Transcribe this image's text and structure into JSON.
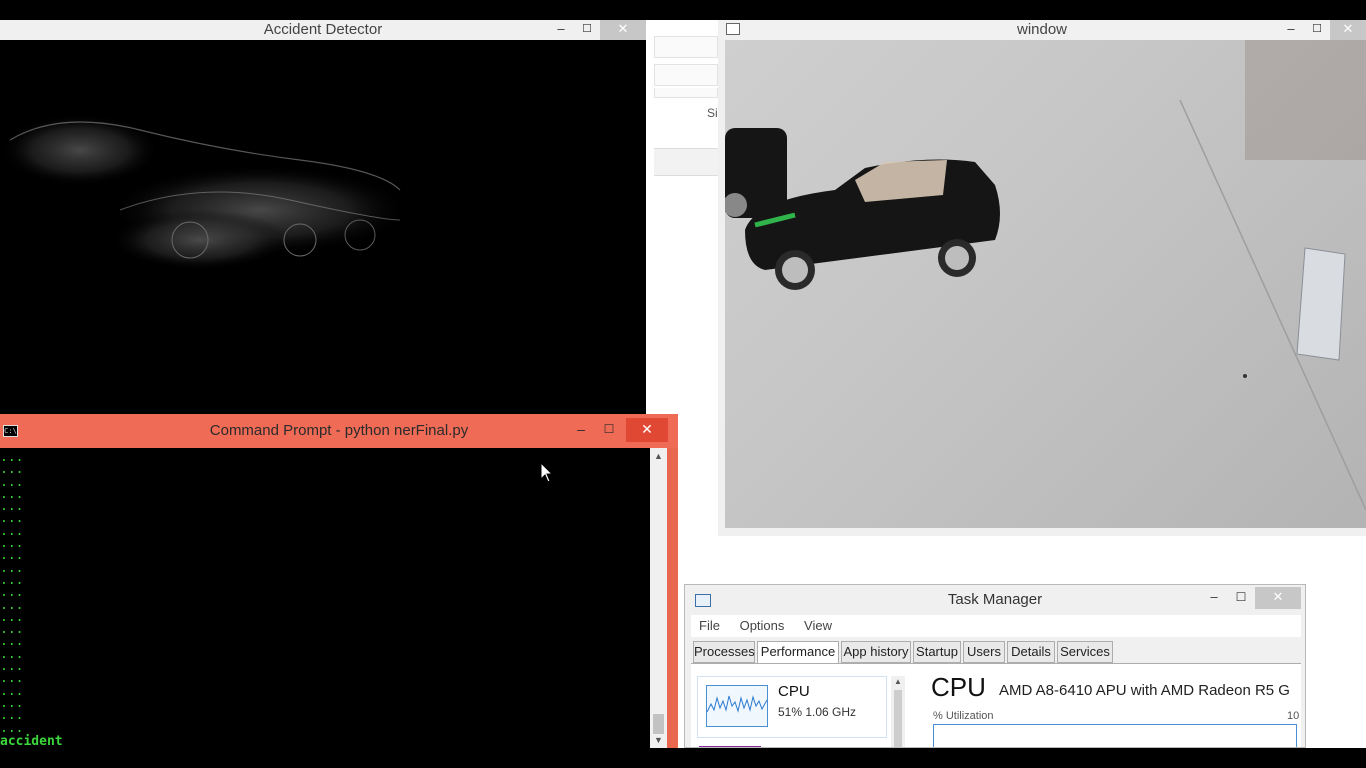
{
  "windows": {
    "detector": {
      "title": "Accident Detector"
    },
    "camera": {
      "title": "window"
    },
    "cmd": {
      "title": "Command Prompt - python  nerFinal.py",
      "icon_text": "C:\\",
      "dots_line": "...",
      "dot_line_count": 23,
      "result_line": "accident"
    },
    "background": {
      "label": "Si"
    },
    "taskmgr": {
      "title": "Task Manager",
      "menu": [
        "File",
        "Options",
        "View"
      ],
      "tabs": [
        "Processes",
        "Performance",
        "App history",
        "Startup",
        "Users",
        "Details",
        "Services"
      ],
      "active_tab": "Performance",
      "cpu_tile": {
        "title": "CPU",
        "stats": "51%  1.06 GHz"
      },
      "cpu_heading": "CPU",
      "cpu_model": "AMD A8-6410 APU with AMD Radeon R5 G",
      "util_label": "% Utilization",
      "util_max": "10"
    }
  },
  "controls": {
    "minimize": "–",
    "maximize": "☐",
    "close": "✕"
  },
  "colors": {
    "cmd_titlebar": "#ef6b56",
    "console_text": "#36d136",
    "console_bg": "#000000"
  }
}
